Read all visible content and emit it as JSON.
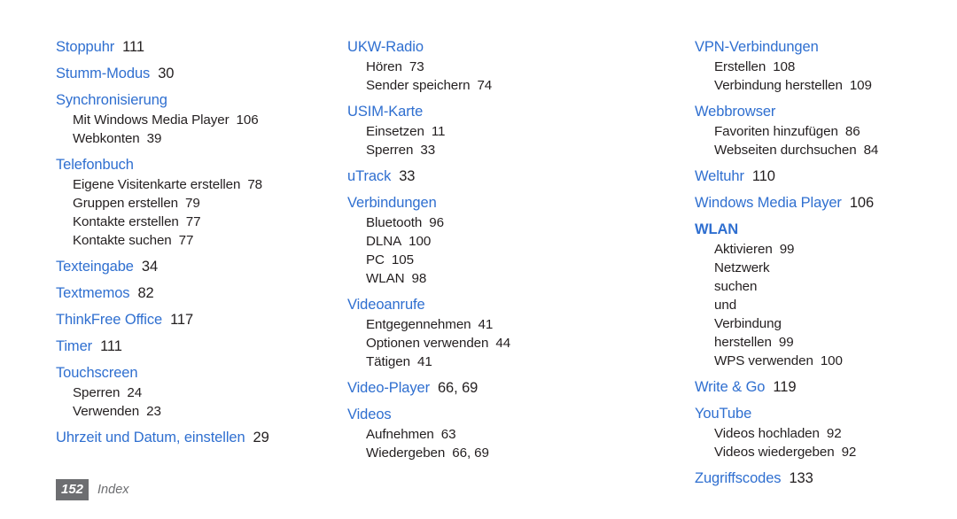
{
  "page": {
    "folio_number": "152",
    "section_label": "Index",
    "heading_color": "#2f6fd0",
    "text_color": "#231f20",
    "folio_background": "#6d6e71"
  },
  "columns": [
    {
      "id": "column-left",
      "entries": [
        {
          "title": "Stoppuhr",
          "page": "111",
          "bold": false,
          "subs": []
        },
        {
          "title": "Stumm-Modus",
          "page": "30",
          "bold": false,
          "subs": []
        },
        {
          "title": "Synchronisierung",
          "page": "",
          "bold": false,
          "subs": [
            {
              "label": "Mit Windows Media Player",
              "page": "106"
            },
            {
              "label": "Webkonten",
              "page": "39"
            }
          ]
        },
        {
          "title": "Telefonbuch",
          "page": "",
          "bold": false,
          "subs": [
            {
              "label": "Eigene Visitenkarte erstellen",
              "page": "78"
            },
            {
              "label": "Gruppen erstellen",
              "page": "79"
            },
            {
              "label": "Kontakte erstellen",
              "page": "77"
            },
            {
              "label": "Kontakte suchen",
              "page": "77"
            }
          ]
        },
        {
          "title": "Texteingabe",
          "page": "34",
          "bold": false,
          "subs": []
        },
        {
          "title": "Textmemos",
          "page": "82",
          "bold": false,
          "subs": []
        },
        {
          "title": "ThinkFree Office",
          "page": "117",
          "bold": false,
          "subs": []
        },
        {
          "title": "Timer",
          "page": "111",
          "bold": false,
          "subs": []
        },
        {
          "title": "Touchscreen",
          "page": "",
          "bold": false,
          "subs": [
            {
              "label": "Sperren",
              "page": "24"
            },
            {
              "label": "Verwenden",
              "page": "23"
            }
          ]
        },
        {
          "title": "Uhrzeit und Datum, einstellen",
          "page": "29",
          "bold": false,
          "subs": []
        }
      ]
    },
    {
      "id": "column-middle",
      "entries": [
        {
          "title": "UKW-Radio",
          "page": "",
          "bold": false,
          "subs": [
            {
              "label": "Hören",
              "page": "73"
            },
            {
              "label": "Sender speichern",
              "page": "74"
            }
          ]
        },
        {
          "title": "USIM-Karte",
          "page": "",
          "bold": false,
          "subs": [
            {
              "label": "Einsetzen",
              "page": "11"
            },
            {
              "label": "Sperren",
              "page": "33"
            }
          ]
        },
        {
          "title": "uTrack",
          "page": "33",
          "bold": false,
          "subs": []
        },
        {
          "title": "Verbindungen",
          "page": "",
          "bold": false,
          "subs": [
            {
              "label": "Bluetooth",
              "page": "96"
            },
            {
              "label": "DLNA",
              "page": "100"
            },
            {
              "label": "PC",
              "page": "105"
            },
            {
              "label": "WLAN",
              "page": "98"
            }
          ]
        },
        {
          "title": "Videoanrufe",
          "page": "",
          "bold": false,
          "subs": [
            {
              "label": "Entgegennehmen",
              "page": "41"
            },
            {
              "label": "Optionen verwenden",
              "page": "44"
            },
            {
              "label": "Tätigen",
              "page": "41"
            }
          ]
        },
        {
          "title": "Video-Player",
          "page": "66, 69",
          "bold": false,
          "subs": []
        },
        {
          "title": "Videos",
          "page": "",
          "bold": false,
          "subs": [
            {
              "label": "Aufnehmen",
              "page": "63"
            },
            {
              "label": "Wiedergeben",
              "page": "66, 69"
            }
          ]
        }
      ]
    },
    {
      "id": "column-right",
      "entries": [
        {
          "title": "VPN-Verbindungen",
          "page": "",
          "bold": false,
          "subs": [
            {
              "label": "Erstellen",
              "page": "108"
            },
            {
              "label": "Verbindung herstellen",
              "page": "109"
            }
          ]
        },
        {
          "title": "Webbrowser",
          "page": "",
          "bold": false,
          "subs": [
            {
              "label": "Favoriten hinzufügen",
              "page": "86"
            },
            {
              "label": "Webseiten durchsuchen",
              "page": "84"
            }
          ]
        },
        {
          "title": "Weltuhr",
          "page": "110",
          "bold": false,
          "subs": []
        },
        {
          "title": "Windows Media Player",
          "page": "106",
          "bold": false,
          "subs": []
        },
        {
          "title": "WLAN",
          "page": "",
          "bold": true,
          "subs": [
            {
              "label": "Aktivieren",
              "page": "99"
            },
            {
              "label": "Netzwerk suchen und Verbindung herstellen",
              "page": "99",
              "wrap": true
            },
            {
              "label": "WPS verwenden",
              "page": "100"
            }
          ]
        },
        {
          "title": "Write & Go",
          "page": "119",
          "bold": false,
          "subs": []
        },
        {
          "title": "YouTube",
          "page": "",
          "bold": false,
          "subs": [
            {
              "label": "Videos hochladen",
              "page": "92"
            },
            {
              "label": "Videos wiedergeben",
              "page": "92"
            }
          ]
        },
        {
          "title": "Zugriffscodes",
          "page": "133",
          "bold": false,
          "subs": []
        }
      ]
    }
  ]
}
